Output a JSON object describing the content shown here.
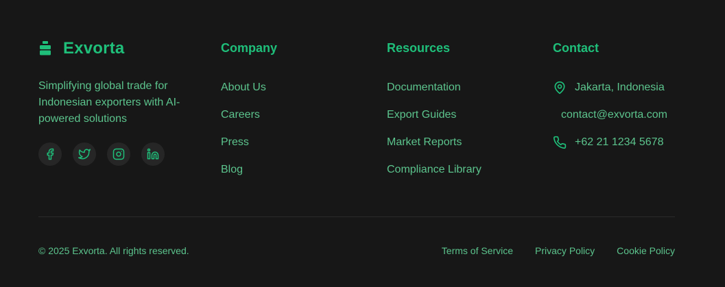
{
  "brand": {
    "name": "Exvorta",
    "logo_icon": "bag-icon",
    "accent": "#1fbf7a"
  },
  "tagline": "Simplifying global trade for Indonesian exporters with AI-powered solutions",
  "socials": [
    {
      "name": "facebook",
      "icon": "facebook-icon"
    },
    {
      "name": "twitter",
      "icon": "twitter-icon"
    },
    {
      "name": "instagram",
      "icon": "instagram-icon"
    },
    {
      "name": "linkedin",
      "icon": "linkedin-icon"
    }
  ],
  "company": {
    "title": "Company",
    "items": [
      "About Us",
      "Careers",
      "Press",
      "Blog"
    ]
  },
  "resources": {
    "title": "Resources",
    "items": [
      "Documentation",
      "Export Guides",
      "Market Reports",
      "Compliance Library"
    ]
  },
  "contact": {
    "title": "Contact",
    "location": "Jakarta, Indonesia",
    "email": "contact@exvorta.com",
    "phone": "+62 21 1234 5678"
  },
  "bottom": {
    "copyright": "© 2025 Exvorta. All rights reserved.",
    "links": [
      "Terms of Service",
      "Privacy Policy",
      "Cookie Policy"
    ]
  },
  "colors": {
    "background": "#171717",
    "text": "#5cc48d",
    "heading": "#1fbf7a"
  }
}
